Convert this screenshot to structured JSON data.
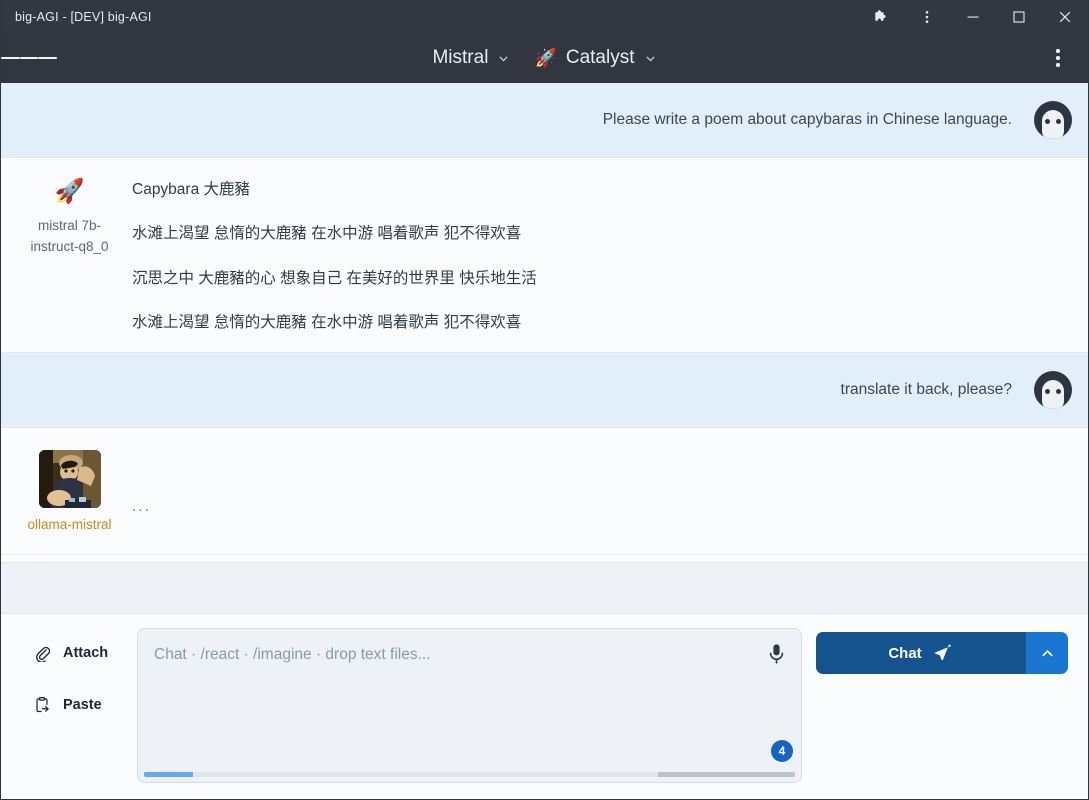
{
  "titlebar": {
    "title": "big-AGI - [DEV] big-AGI",
    "controls": [
      {
        "name": "extensions-icon",
        "label": "Extensions"
      },
      {
        "name": "browser-menu-icon",
        "label": "Menu"
      },
      {
        "name": "minimize-icon",
        "label": "Minimize"
      },
      {
        "name": "maximize-icon",
        "label": "Maximize"
      },
      {
        "name": "close-icon",
        "label": "Close"
      }
    ]
  },
  "header": {
    "menu_label": "Menu",
    "model_vendor": "Mistral",
    "persona_emoji": "🚀",
    "persona_label": "Catalyst",
    "options_label": "Options"
  },
  "messages": [
    {
      "role": "user",
      "text": "Please write a poem about capybaras in Chinese language.",
      "avatar": "person-avatar"
    },
    {
      "role": "assistant",
      "persona_emoji": "🚀",
      "persona_name": "mistral 7b-instruct-q8_0",
      "lines": [
        "Capybara 大鹿豬",
        "水滩上渴望 怠惰的大鹿豬 在水中游 唱着歌声 犯不得欢喜",
        "沉思之中 大鹿豬的心 想象自己 在美好的世界里 快乐地生活",
        "水滩上渴望 怠惰的大鹿豬 在水中游 唱着歌声 犯不得欢喜"
      ]
    },
    {
      "role": "user",
      "text": "translate it back, please?",
      "avatar": "person-avatar"
    },
    {
      "role": "assistant",
      "persona_name": "ollama-mistral",
      "persona_avatar": "photo-avatar",
      "typing_indicator": "..."
    }
  ],
  "composer": {
    "attach_label": "Attach",
    "paste_label": "Paste",
    "textarea_value": "",
    "textarea_placeholder": "Chat · /react · /imagine · drop text files...",
    "mic_label": "Speech to text",
    "token_count": "4",
    "send_label": "Chat",
    "send_more_label": "More send options"
  },
  "colors": {
    "titlebar_bg": "#323842",
    "header_bg": "#313640",
    "user_message_bg": "#e3eefb",
    "assistant_message_bg": "#fbfcfe",
    "accent_blue": "#15538f",
    "split_blue": "#1876d1",
    "badge_blue": "#1565c0",
    "ollama_label": "#c98a1f"
  }
}
